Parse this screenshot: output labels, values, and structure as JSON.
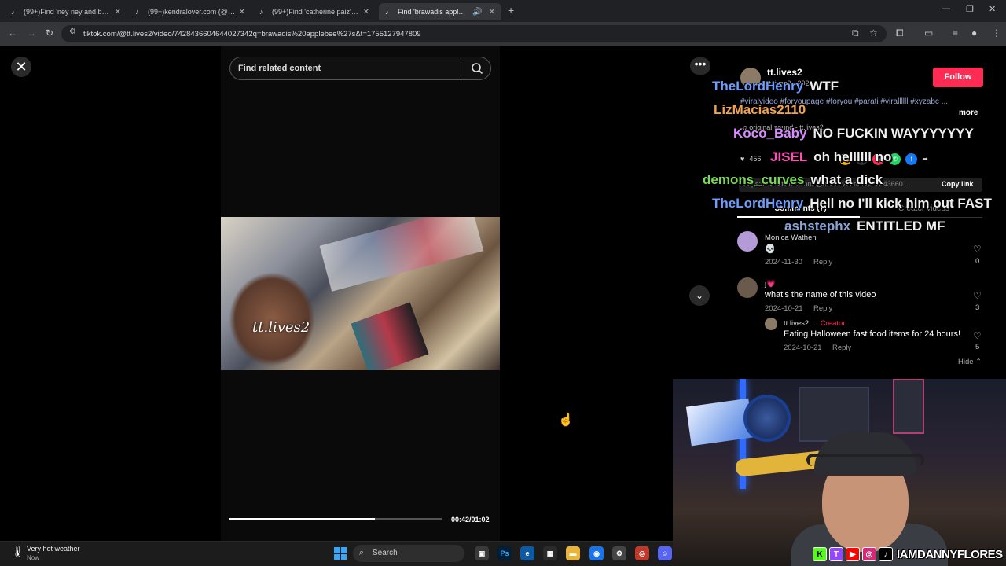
{
  "browser": {
    "tabs": [
      {
        "label": "(99+)Find 'ney ney and bolsao",
        "active": false
      },
      {
        "label": "(99+)kendralover.com (@kendr",
        "active": false
      },
      {
        "label": "(99+)Find 'catherine paiz' on Ti",
        "active": false
      },
      {
        "label": "Find 'brawadis applebee's'",
        "active": true
      }
    ],
    "url": "tiktok.com/@tt.lives2/video/7428436604644027342q=brawadis%20applebee%27s&t=1755127947809"
  },
  "player": {
    "search_placeholder": "Find related content",
    "watermark": "tt.lives2",
    "timecode": "00:42/01:02",
    "progress": 0.687
  },
  "post": {
    "author": "tt.lives2",
    "author_sub": "tt.lives2 · 2024-10-21",
    "follow_label": "Follow",
    "description": "#viralvideo #foryoupage #foryou #parati #virallllll #xyzabc ...",
    "more_label": "more",
    "sound": "♫ original sound - tt.lives2",
    "likes": "456",
    "link": "https://www.tiktok.com/@tt.lives2/video/742843660...",
    "copy_link_label": "Copy link",
    "tabs": {
      "comments": "Comments (7)",
      "creator": "Creator videos"
    }
  },
  "comments": [
    {
      "name": "Monica Wathen",
      "text": "💀",
      "date": "2024-11-30",
      "reply": "Reply",
      "likes": "0"
    },
    {
      "name": "j💗",
      "text": "what's the name of this video",
      "date": "2024-10-21",
      "reply": "Reply",
      "likes": "3"
    },
    {
      "name": "tt.lives2",
      "creator_badge": "· Creator",
      "text": "Eating Halloween fast food items for 24 hours!",
      "date": "2024-10-21",
      "reply": "Reply",
      "likes": "5"
    }
  ],
  "hide_label": "Hide ⌃",
  "chat": [
    {
      "user": "TheLordHenry",
      "msg": "WTF",
      "color": "#6e9dff"
    },
    {
      "user": "LizMacias2110",
      "msg": "",
      "color": "#f4a24c"
    },
    {
      "user": "Koco_Baby",
      "msg": "NO FUCKIN WAYYYYYYY",
      "color": "#d98cff"
    },
    {
      "user": "JISEL",
      "msg": "oh hellllll no",
      "color": "#ff4fb8"
    },
    {
      "user": "demons_curves",
      "msg": "what a dick",
      "color": "#7ad957"
    },
    {
      "user": "TheLordHenry",
      "msg": "Hell no I'll kick him out FAST",
      "color": "#6e9dff"
    },
    {
      "user": "ashstephx",
      "msg": "ENTITLED MF",
      "color": "#8aa4d6"
    }
  ],
  "stream": {
    "handle": "IAMDANNYFLORES",
    "socials": [
      "K",
      "T",
      "▶",
      "◎",
      "♪"
    ]
  },
  "taskbar": {
    "weather_title": "Very hot weather",
    "weather_sub": "Now",
    "search_label": "Search"
  }
}
